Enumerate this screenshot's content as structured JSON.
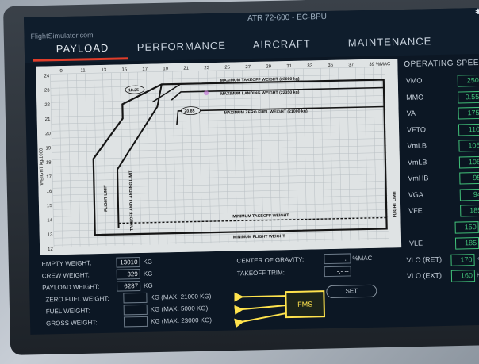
{
  "header": {
    "brand": "FlightSimulator.com",
    "aircraft_title": "ATR 72-600 - EC-BPU",
    "tabs": [
      "PAYLOAD",
      "PERFORMANCE",
      "AIRCRAFT",
      "MAINTENANCE"
    ],
    "active_tab": "PAYLOAD",
    "status_icons": "✱ ⌁"
  },
  "chart": {
    "x_ticks": [
      "9",
      "11",
      "13",
      "15",
      "17",
      "19",
      "21",
      "23",
      "25",
      "27",
      "29",
      "31",
      "33",
      "35",
      "37",
      "39 %MAC"
    ],
    "y_ticks": [
      "24",
      "23",
      "22",
      "21",
      "20",
      "19",
      "18",
      "17",
      "16",
      "15",
      "14",
      "13",
      "12"
    ],
    "y_axis_label": "WEIGHT kg/1000",
    "labels": {
      "max_takeoff": "MAXIMUM TAKEOFF WEIGHT (23000 kg)",
      "max_landing": "MAXIMUM LANDING WEIGHT (22350 kg)",
      "max_zero_fuel": "MAXIMUM ZERO FUEL WEIGHT (21000 kg)",
      "min_takeoff": "MINIMUM TAKEOFF WEIGHT",
      "min_flight": "MINIMUM FLIGHT WEIGHT",
      "flight_limit_left": "FLIGHT LIMIT",
      "flight_limit_right": "FLIGHT LIMIT",
      "takeoff_landing_limit": "TAKEOFF AND LANDING LIMIT",
      "callout_1": "18.25",
      "callout_2": "20.85"
    }
  },
  "weights": {
    "empty_label": "EMPTY WEIGHT:",
    "empty_value": "13010",
    "empty_unit": "KG",
    "crew_label": "CREW WEIGHT:",
    "crew_value": "329",
    "crew_unit": "KG",
    "payload_label": "PAYLOAD WEIGHT:",
    "payload_value": "6287",
    "payload_unit": "KG",
    "zfw_label": "ZERO FUEL WEIGHT:",
    "zfw_value": "",
    "zfw_unit": "KG (MAX. 21000 KG)",
    "fuel_label": "FUEL WEIGHT:",
    "fuel_value": "",
    "fuel_unit": "KG (MAX. 5000 KG)",
    "gross_label": "GROSS WEIGHT:",
    "gross_value": "",
    "gross_unit": "KG (MAX. 23000 KG)"
  },
  "cg": {
    "cg_label": "CENTER OF GRAVITY:",
    "cg_value": "--.-",
    "cg_unit": "%MAC",
    "trim_label": "TAKEOFF TRIM:",
    "trim_value": "-.- --",
    "set_button": "SET"
  },
  "fms_annotation": "FMS",
  "operating_speeds": {
    "title": "OPERATING SPEE",
    "rows": [
      {
        "label": "VMO",
        "value": "250"
      },
      {
        "label": "MMO",
        "value": "0.55"
      },
      {
        "label": "VA",
        "value": "175"
      },
      {
        "label": "VFTO",
        "value": "110"
      },
      {
        "label": "VmLB",
        "value": "106"
      },
      {
        "label": "VmLB",
        "value": "106"
      },
      {
        "label": "VmHB",
        "value": "95"
      },
      {
        "label": "VGA",
        "value": "94"
      },
      {
        "label": "VFE",
        "value": "185"
      },
      {
        "label": "",
        "value": "150"
      },
      {
        "label": "VLE",
        "value": "185"
      },
      {
        "label": "VLO (RET)",
        "value": "170"
      },
      {
        "label": "VLO (EXT)",
        "value": "160"
      }
    ],
    "unit_glyph": "K"
  },
  "colors": {
    "accent_red": "#e03d2a",
    "speed_green": "#42c27a",
    "fms_yellow": "#ffe34d"
  }
}
